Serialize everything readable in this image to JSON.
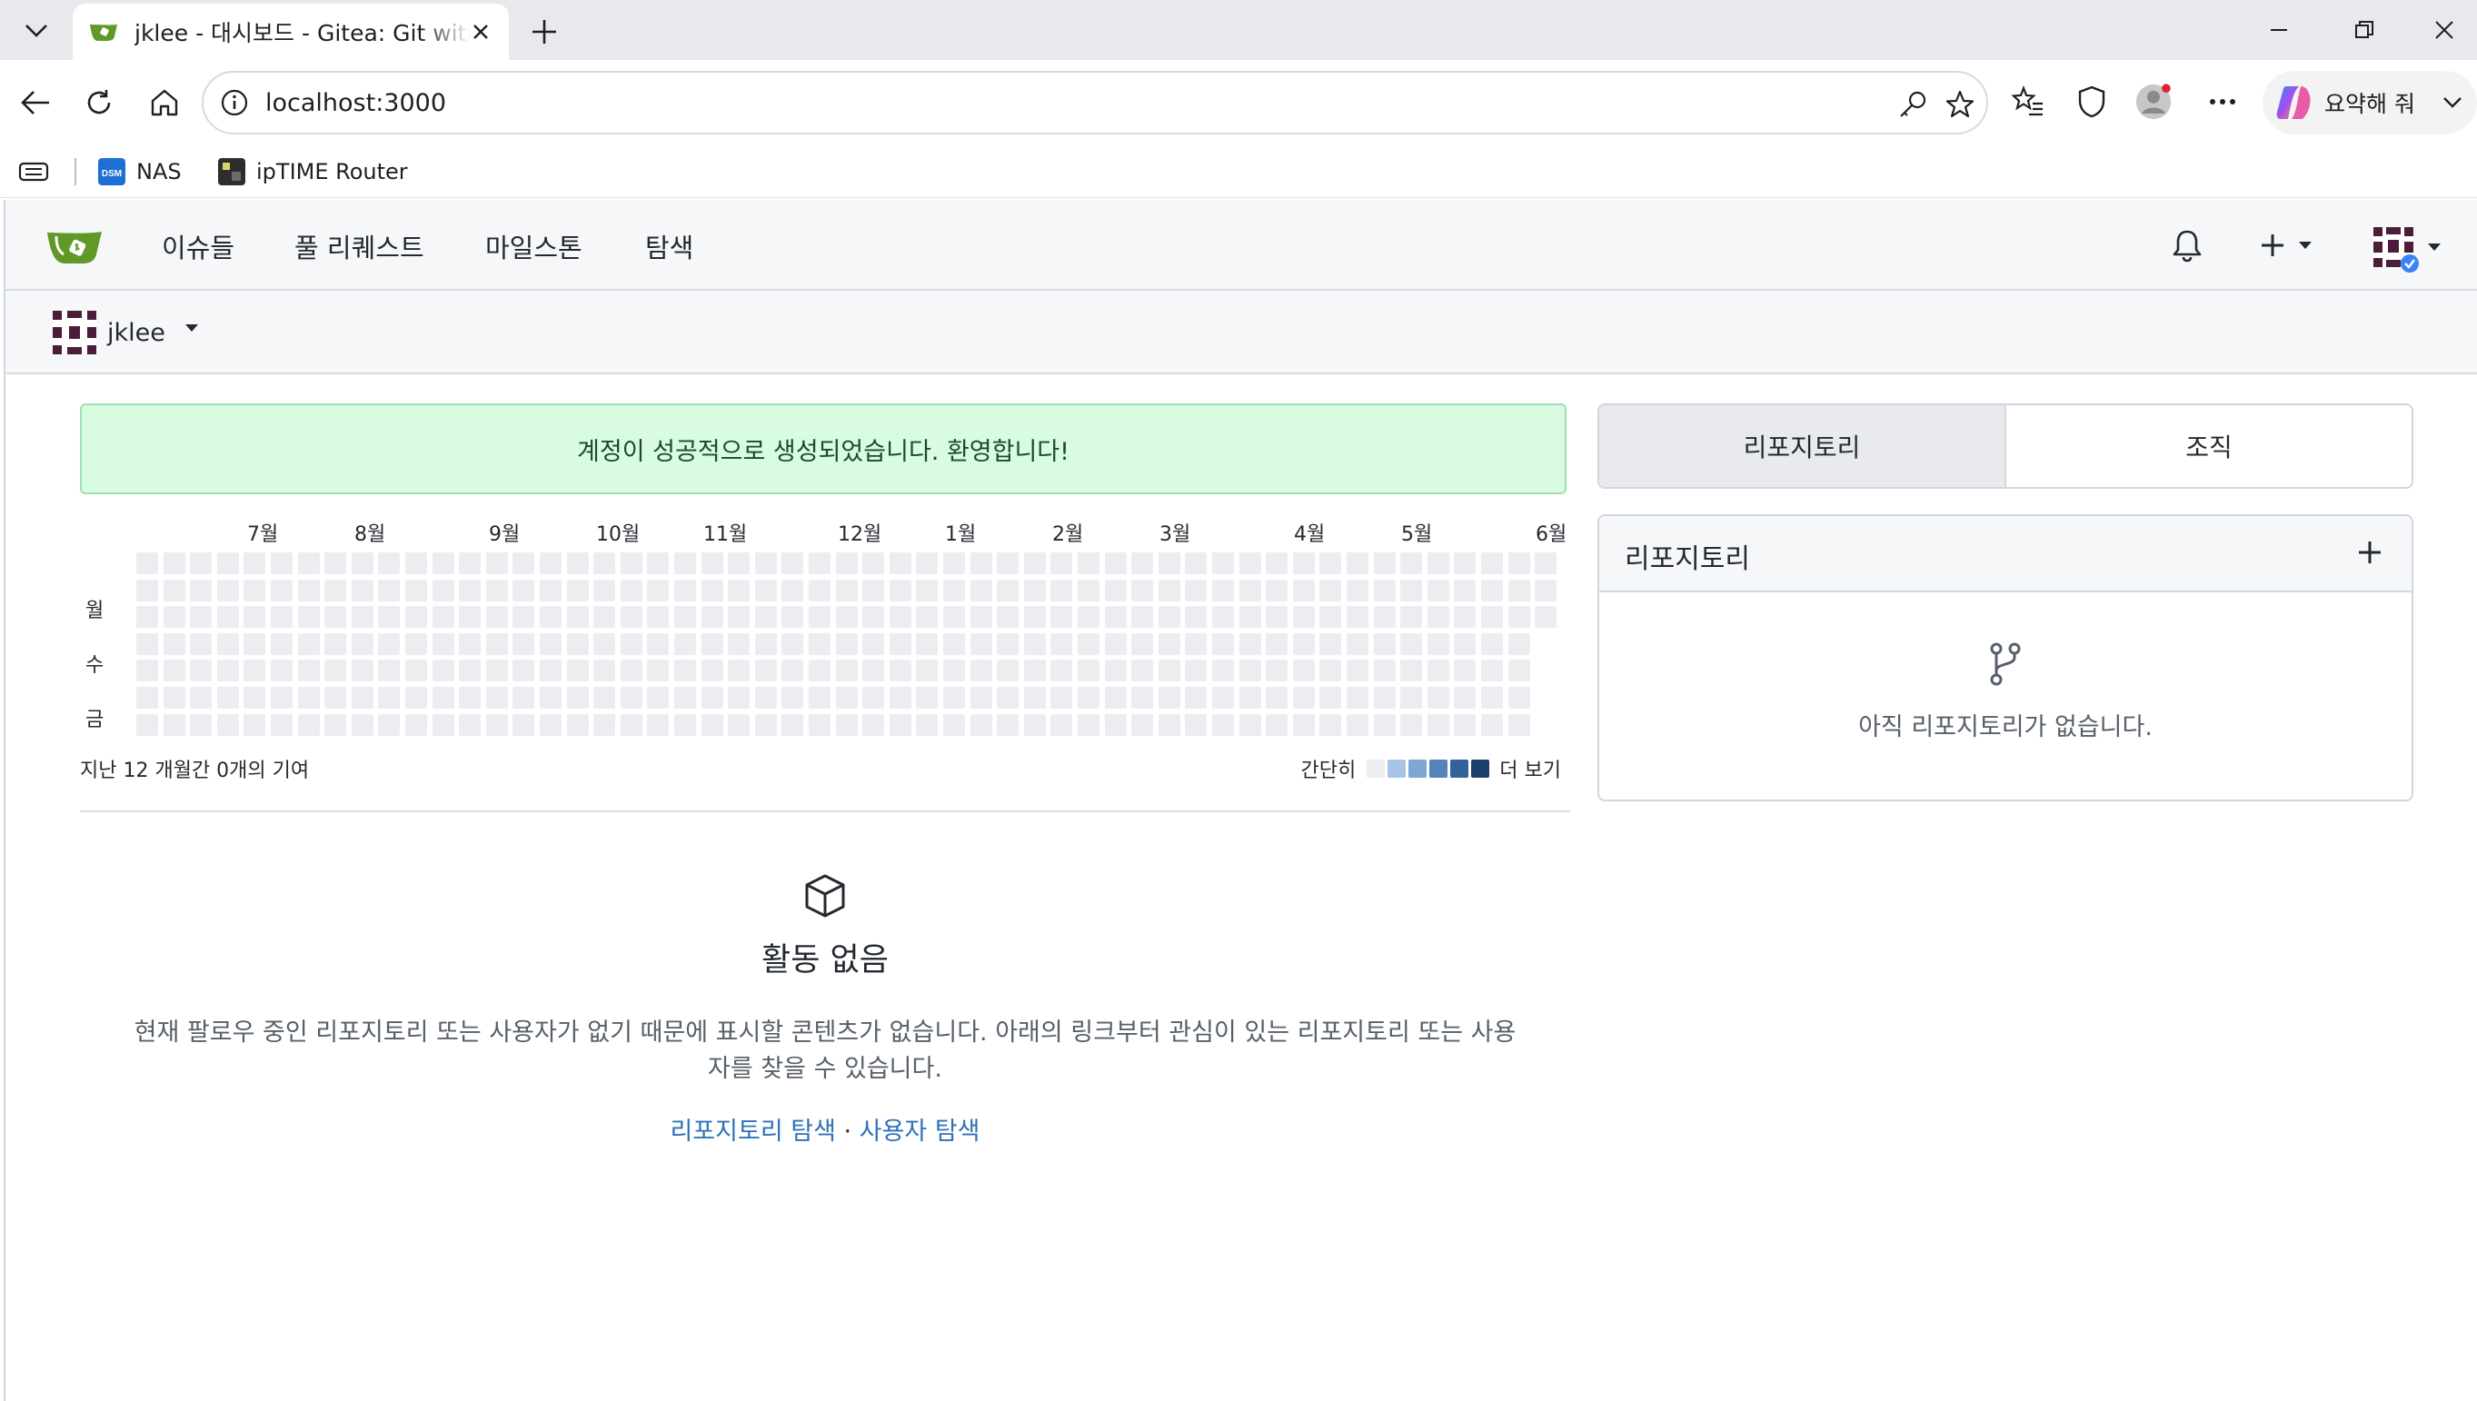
{
  "browser": {
    "tab_title": "jklee - 대시보드 - Gitea: Git with a cup of tea",
    "url": "localhost:3000",
    "copilot_label": "요약해 줘",
    "bookmarks": [
      {
        "label": "NAS",
        "icon": "dsm-icon"
      },
      {
        "label": "ipTIME Router",
        "icon": "router-icon"
      }
    ]
  },
  "nav": {
    "items": [
      "이슈들",
      "풀 리퀘스트",
      "마일스톤",
      "탐색"
    ]
  },
  "context": {
    "user": "jklee"
  },
  "flash": {
    "message": "계정이 성공적으로 생성되었습니다. 환영합니다!"
  },
  "heatmap": {
    "months": [
      "7월",
      "8월",
      "9월",
      "10월",
      "11월",
      "12월",
      "1월",
      "2월",
      "3월",
      "4월",
      "5월",
      "6월"
    ],
    "days": [
      "월",
      "수",
      "금"
    ],
    "summary": "지난 12 개월간 0개의 기여",
    "legend_less": "간단히",
    "legend_more": "더 보기",
    "legend_colors": [
      "#ebedf0",
      "#a8c4e4",
      "#7fa6d4",
      "#5582bc",
      "#346199",
      "#1d3f6e"
    ]
  },
  "feed": {
    "heading": "활동 없음",
    "description": "현재 팔로우 중인 리포지토리 또는 사용자가 없기 때문에 표시할 콘텐츠가 없습니다. 아래의 링크부터 관심이 있는 리포지토리 또는 사용자를 찾을 수 있습니다.",
    "link_repos": "리포지토리 탐색",
    "separator": "·",
    "link_users": "사용자 탐색"
  },
  "sidebar": {
    "tabs": [
      "리포지토리",
      "조직"
    ],
    "panel_title": "리포지토리",
    "empty_message": "아직 리포지토리가 없습니다."
  },
  "colors": {
    "flash_bg": "#d9fbe1",
    "link": "#2f72b8",
    "gitea_green": "#609926"
  }
}
